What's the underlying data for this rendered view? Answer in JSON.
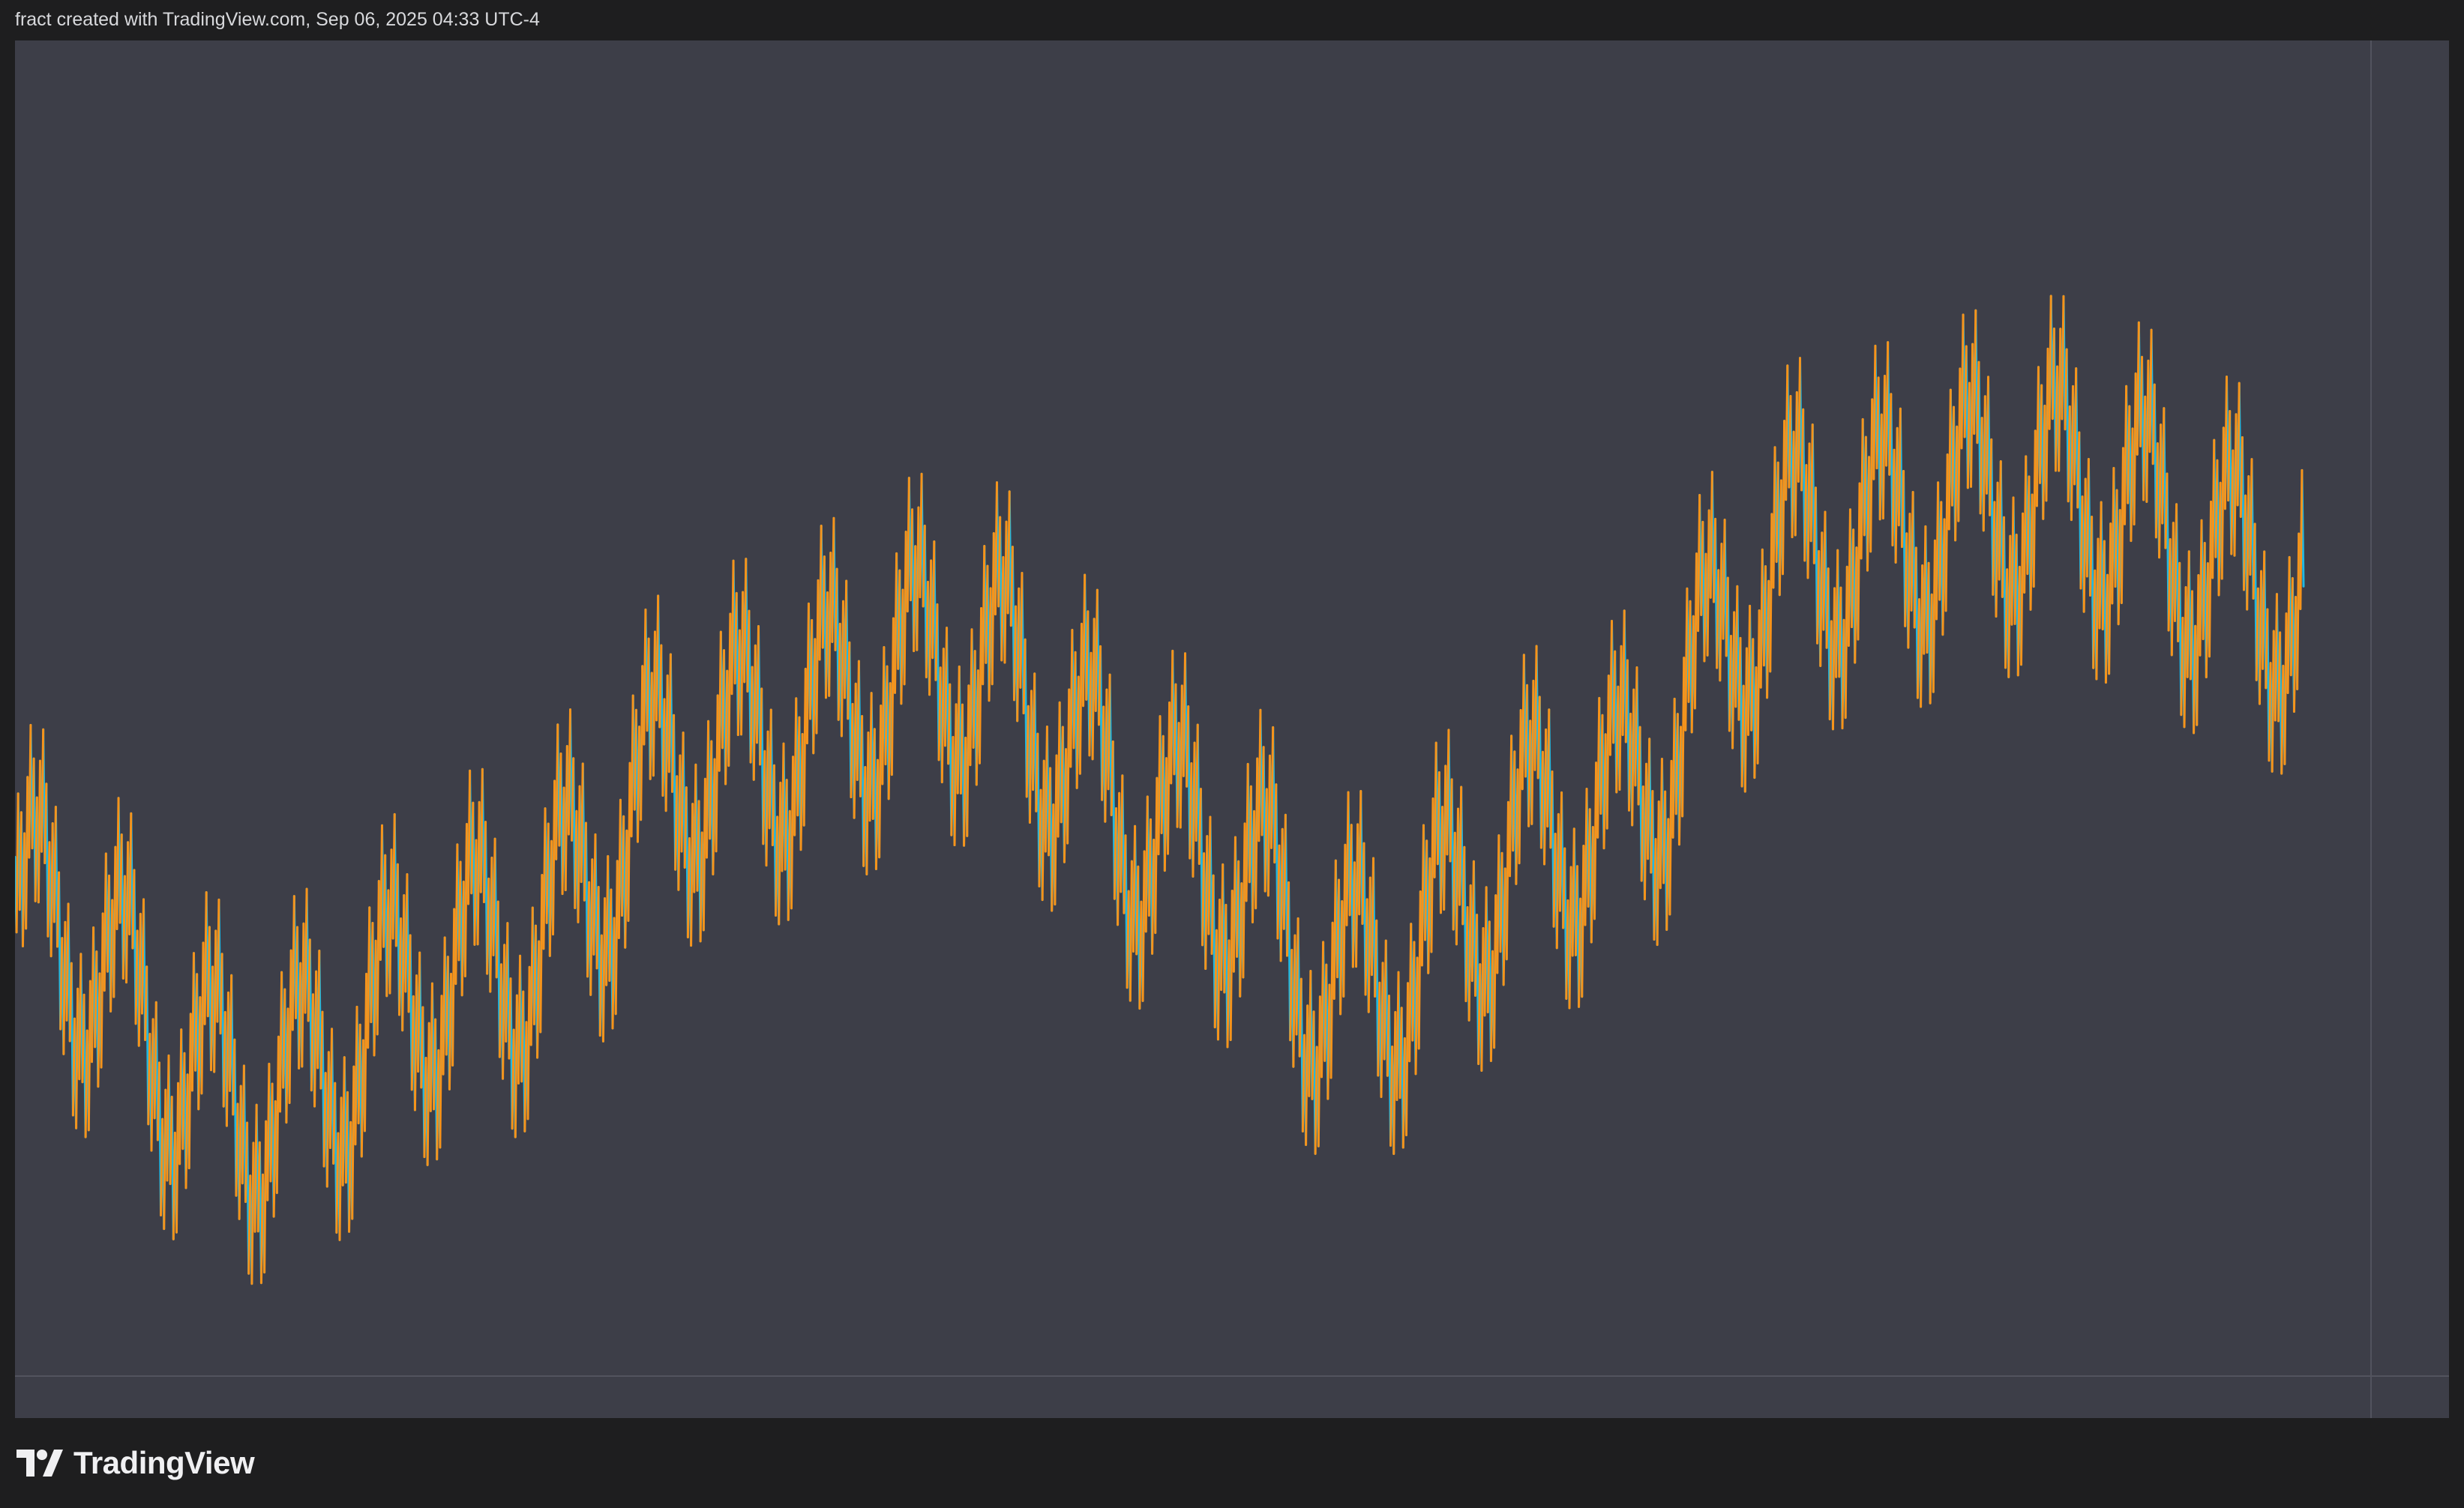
{
  "header": {
    "caption": "fract created with TradingView.com, Sep 06, 2025 04:33 UTC-4"
  },
  "brand": {
    "name": "TradingView",
    "logo_icon": "tradingview-logo-icon"
  },
  "colors": {
    "background": "#1e1e1f",
    "panel": "#3d3e48",
    "up_color": "#f7931a",
    "down_color": "#22b8e0",
    "caption_text": "#d8d9dc"
  },
  "chart_data": {
    "type": "line",
    "title": "",
    "xlabel": "",
    "ylabel": "",
    "grid": false,
    "legend": "none",
    "ylim": [
      0,
      100
    ],
    "num_points": 1460,
    "trend_keypoints": {
      "x": [
        0,
        150,
        300,
        450,
        600,
        750,
        850,
        1000,
        1150,
        1300,
        1460
      ],
      "y": [
        34,
        18,
        30,
        48,
        56,
        40,
        28,
        42,
        66,
        71,
        62
      ]
    },
    "oscillation": {
      "primary_period": 56,
      "primary_amplitude": 9,
      "secondary_period": 8,
      "secondary_amplitude": 3.5,
      "jitter_period": 2,
      "jitter_amplitude": 5
    },
    "series": [
      {
        "name": "",
        "color": "#f7931a"
      },
      {
        "name": "",
        "color": "#22b8e0"
      }
    ]
  }
}
